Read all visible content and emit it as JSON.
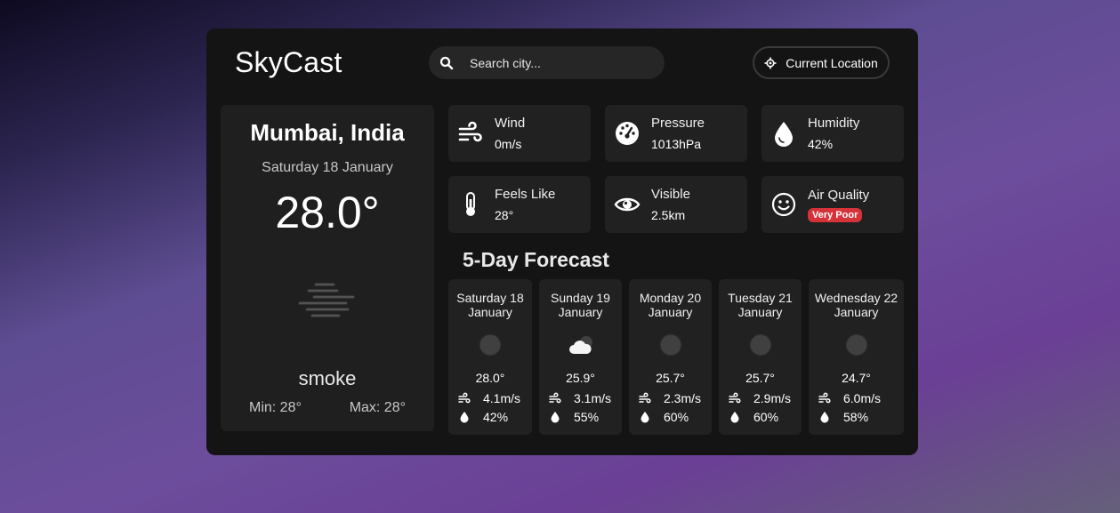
{
  "app": {
    "title": "SkyCast",
    "search": {
      "placeholder": "Search city..."
    },
    "location_button": "Current Location"
  },
  "current": {
    "city": "Mumbai, India",
    "date": "Saturday 18 January",
    "temperature": "28.0°",
    "condition": "smoke",
    "min": "Min: 28°",
    "max": "Max: 28°",
    "icon": "smoke-icon"
  },
  "stats": [
    {
      "label": "Wind",
      "value": "0m/s",
      "icon": "wind-icon"
    },
    {
      "label": "Pressure",
      "value": "1013hPa",
      "icon": "gauge-icon"
    },
    {
      "label": "Humidity",
      "value": "42%",
      "icon": "droplet-icon"
    },
    {
      "label": "Feels Like",
      "value": "28°",
      "icon": "thermometer-icon"
    },
    {
      "label": "Visible",
      "value": "2.5km",
      "icon": "eye-icon"
    },
    {
      "label": "Air Quality",
      "value": "Very Poor",
      "icon": "smiley-icon",
      "badge_color": "#d6323a"
    }
  ],
  "forecast": {
    "title": "5-Day Forecast",
    "days": [
      {
        "day": "Saturday 18",
        "month": "January",
        "temp": "28.0°",
        "wind": "4.1m/s",
        "humidity": "42%",
        "icon": "moon-icon"
      },
      {
        "day": "Sunday 19",
        "month": "January",
        "temp": "25.9°",
        "wind": "3.1m/s",
        "humidity": "55%",
        "icon": "cloud-night-icon"
      },
      {
        "day": "Monday 20",
        "month": "January",
        "temp": "25.7°",
        "wind": "2.3m/s",
        "humidity": "60%",
        "icon": "moon-icon"
      },
      {
        "day": "Tuesday 21",
        "month": "January",
        "temp": "25.7°",
        "wind": "2.9m/s",
        "humidity": "60%",
        "icon": "moon-icon"
      },
      {
        "day": "Wednesday 22",
        "month": "January",
        "temp": "24.7°",
        "wind": "6.0m/s",
        "humidity": "58%",
        "icon": "moon-icon"
      }
    ]
  }
}
